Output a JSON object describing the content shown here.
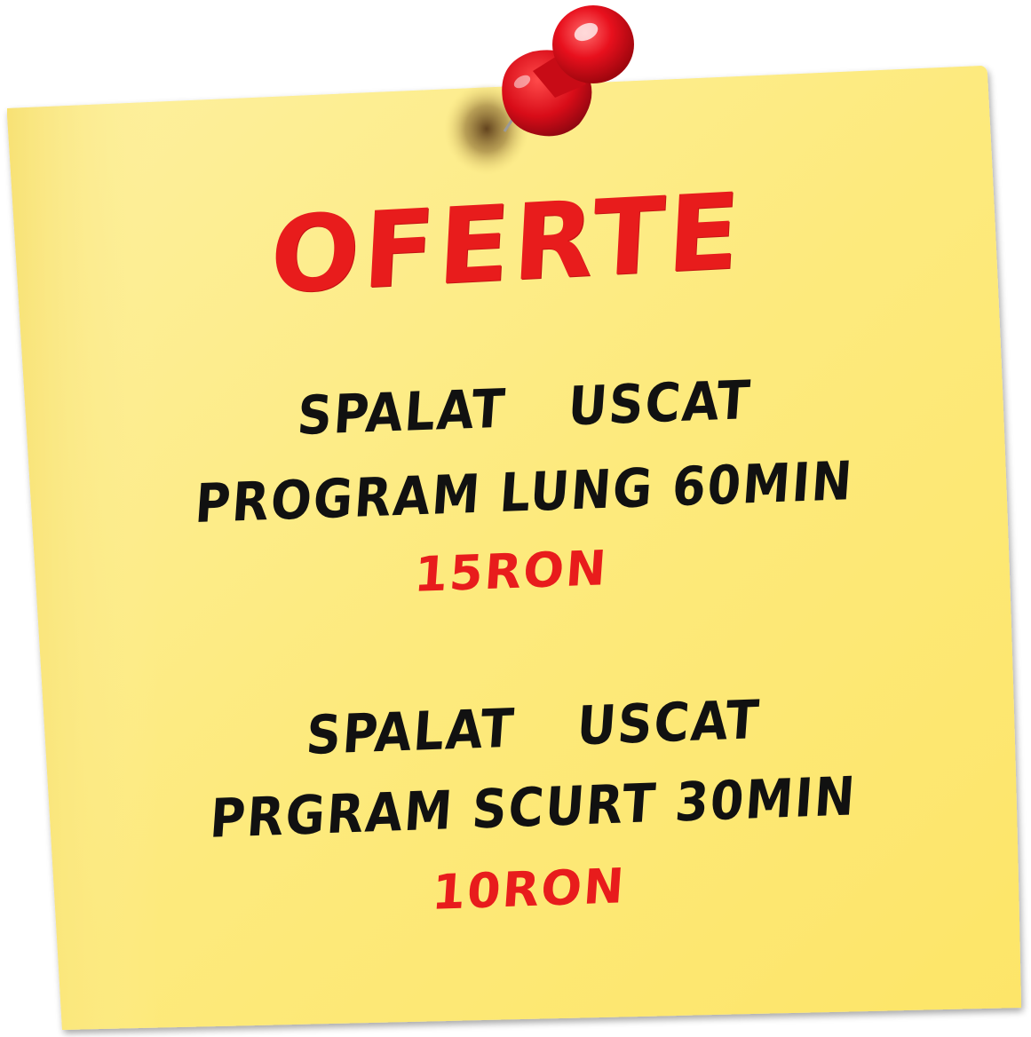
{
  "note": {
    "title": "OFERTE",
    "offers": [
      {
        "service_left": "SPALAT",
        "service_right": "USCAT",
        "program": "PROGRAM LUNG 60MIN",
        "price": "15RON"
      },
      {
        "service_left": "SPALAT",
        "service_right": "USCAT",
        "program": "PRGRAM SCURT 30MIN",
        "price": "10RON"
      }
    ]
  },
  "colors": {
    "paper": "#fde97a",
    "title_red": "#e81c1c",
    "text_black": "#111111",
    "pin_red": "#e60f1e"
  },
  "icons": {
    "pin": "push-pin-icon"
  }
}
